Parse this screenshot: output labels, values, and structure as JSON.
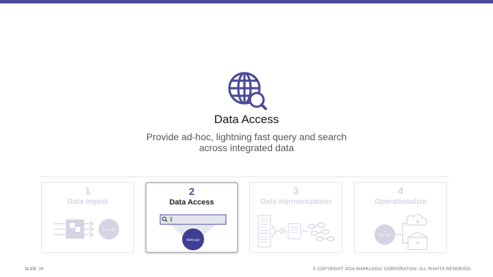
{
  "colors": {
    "accent": "#4a4a9a",
    "faded": "#d6d6e6"
  },
  "hero": {
    "icon": "globe-search-icon",
    "title": "Data Access",
    "subtitle_line1": "Provide ad-hoc, lightning fast query and search",
    "subtitle_line2": "across integrated data"
  },
  "steps": [
    {
      "number": "1",
      "label": "Data Ingest",
      "active": false
    },
    {
      "number": "2",
      "label": "Data Access",
      "active": true
    },
    {
      "number": "3",
      "label": "Data Harmonization",
      "active": false
    },
    {
      "number": "4",
      "label": "Operationalize",
      "active": false
    }
  ],
  "logo_text": "MarkLogic",
  "footer": {
    "slide": "SLIDE: 24",
    "copyright": "© COPYRIGHT 2016 MARKLOGIC CORPORATION. ALL RIGHTS RESERVED."
  }
}
